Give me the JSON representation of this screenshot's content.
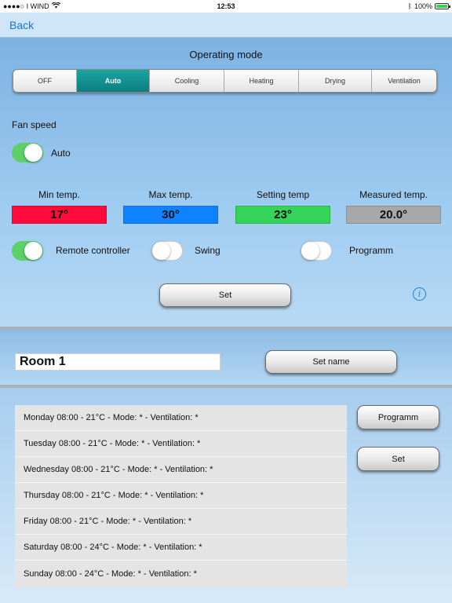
{
  "status_bar": {
    "carrier": "●●●●○ I WIND",
    "time": "12:53",
    "battery_text": "100%"
  },
  "nav": {
    "back_label": "Back"
  },
  "operating_mode": {
    "title": "Operating mode",
    "modes": [
      "OFF",
      "Auto",
      "Cooling",
      "Heating",
      "Drying",
      "Ventilation"
    ],
    "selected": "Auto"
  },
  "fan": {
    "title": "Fan speed",
    "label": "Auto",
    "toggle_on": true
  },
  "temps": [
    {
      "label": "Min temp.",
      "value": "17°",
      "color": "#ff0a3a"
    },
    {
      "label": "Max temp.",
      "value": "30°",
      "color": "#0f82ff"
    },
    {
      "label": "Setting temp",
      "value": "23°",
      "color": "#34d35a"
    },
    {
      "label": "Measured temp.",
      "value": "20.0°",
      "color": "#a8a8a8"
    }
  ],
  "toggles": {
    "remote": {
      "label": "Remote controller",
      "on": true
    },
    "swing": {
      "label": "Swing",
      "on": false
    },
    "programm": {
      "label": "Programm",
      "on": false
    }
  },
  "set_button_label": "Set",
  "room": {
    "name": "Room 1",
    "set_name_label": "Set name"
  },
  "schedule": {
    "rows": [
      "Monday 08:00 - 21°C  -  Mode: *  -  Ventilation: *",
      "Tuesday 08:00 - 21°C  -  Mode: *  -  Ventilation: *",
      "Wednesday 08:00 - 21°C  -  Mode: *  -  Ventilation: *",
      "Thursday 08:00 - 21°C  -  Mode: *  -  Ventilation: *",
      "Friday 08:00 - 21°C  -  Mode: *  -  Ventilation: *",
      "Saturday 08:00 - 24°C  -  Mode: *  -  Ventilation: *",
      "Sunday 08:00 - 24°C  -  Mode: *  -  Ventilation: *"
    ],
    "programm_button_label": "Programm",
    "set_button_label": "Set"
  },
  "colors": {
    "accent": "#1a74d8",
    "active_segment": "#0d7d80",
    "toggle_on": "#5dd168"
  }
}
